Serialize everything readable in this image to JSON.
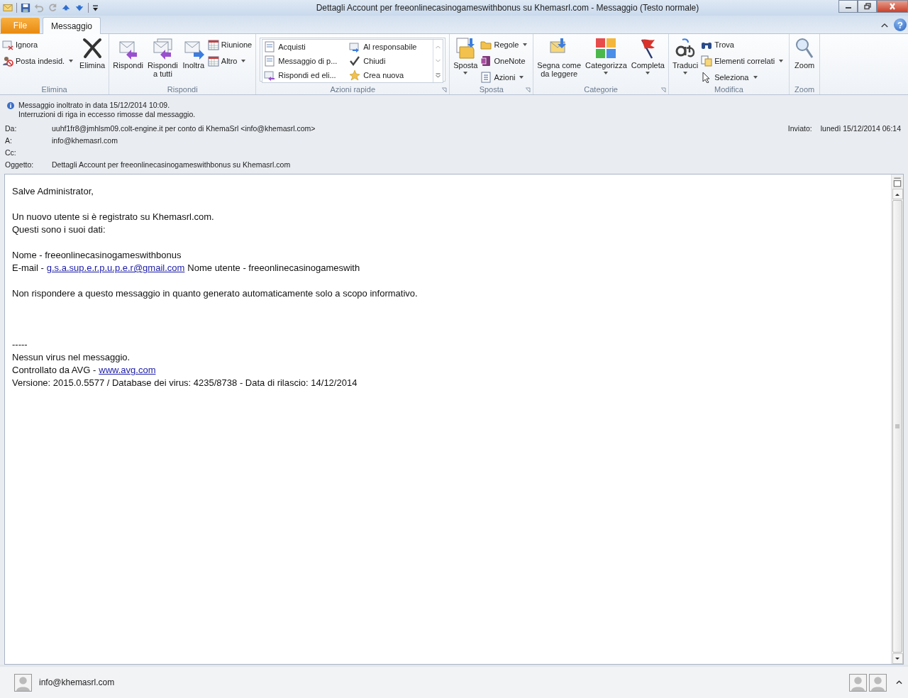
{
  "window": {
    "title": "Dettagli Account per freeonlinecasinogameswithbonus su Khemasrl.com  -  Messaggio (Testo normale)",
    "help": "?"
  },
  "tabs": [
    {
      "label": "File",
      "kind": "file",
      "selected": false
    },
    {
      "label": "Messaggio",
      "kind": "tab",
      "selected": true
    }
  ],
  "ribbon": {
    "groups": [
      {
        "label": "Elimina",
        "launcher": false,
        "columns": [
          {
            "kind": "small",
            "items": [
              {
                "lines": [
                  "Ignora"
                ],
                "dropdown": false
              },
              {
                "lines": [
                  "Posta indesid."
                ],
                "dropdown": true
              }
            ]
          },
          {
            "kind": "large",
            "items": [
              {
                "lines": [
                  "Elimina"
                ],
                "dropdown": false
              }
            ]
          }
        ]
      },
      {
        "label": "Rispondi",
        "launcher": false,
        "columns": [
          {
            "kind": "large",
            "items": [
              {
                "lines": [
                  "Rispondi"
                ],
                "dropdown": false
              }
            ]
          },
          {
            "kind": "large",
            "items": [
              {
                "lines": [
                  "Rispondi",
                  "a tutti"
                ],
                "dropdown": false
              }
            ]
          },
          {
            "kind": "large",
            "items": [
              {
                "lines": [
                  "Inoltra"
                ],
                "dropdown": false
              }
            ]
          },
          {
            "kind": "small",
            "items": [
              {
                "lines": [
                  "Riunione"
                ],
                "dropdown": false
              },
              {
                "lines": [
                  "Altro"
                ],
                "dropdown": true
              }
            ]
          }
        ]
      },
      {
        "label": "Azioni rapide",
        "launcher": true,
        "columns": [
          {
            "kind": "gallery",
            "items": [
              {
                "lines": [
                  "Acquisti"
                ]
              },
              {
                "lines": [
                  "Messaggio di p..."
                ]
              },
              {
                "lines": [
                  "Rispondi ed eli..."
                ]
              },
              {
                "lines": [
                  "Al responsabile"
                ]
              },
              {
                "lines": [
                  "Chiudi"
                ]
              },
              {
                "lines": [
                  "Crea nuova"
                ]
              }
            ]
          }
        ]
      },
      {
        "label": "Sposta",
        "launcher": true,
        "columns": [
          {
            "kind": "large",
            "items": [
              {
                "lines": [
                  "Sposta"
                ],
                "dropdown": true
              }
            ]
          },
          {
            "kind": "small",
            "items": [
              {
                "lines": [
                  "Regole"
                ],
                "dropdown": true
              },
              {
                "lines": [
                  "OneNote"
                ],
                "dropdown": false
              },
              {
                "lines": [
                  "Azioni"
                ],
                "dropdown": true
              }
            ]
          }
        ]
      },
      {
        "label": "Categorie",
        "launcher": true,
        "columns": [
          {
            "kind": "large",
            "items": [
              {
                "lines": [
                  "Segna come",
                  "da leggere"
                ],
                "dropdown": false
              }
            ]
          },
          {
            "kind": "large",
            "items": [
              {
                "lines": [
                  "Categorizza"
                ],
                "dropdown": true
              }
            ]
          },
          {
            "kind": "large",
            "items": [
              {
                "lines": [
                  "Completa"
                ],
                "dropdown": true
              }
            ]
          }
        ]
      },
      {
        "label": "Modifica",
        "launcher": false,
        "columns": [
          {
            "kind": "large",
            "items": [
              {
                "lines": [
                  "Traduci"
                ],
                "dropdown": true
              }
            ]
          },
          {
            "kind": "small",
            "items": [
              {
                "lines": [
                  "Trova"
                ],
                "dropdown": false
              },
              {
                "lines": [
                  "Elementi correlati"
                ],
                "dropdown": true
              },
              {
                "lines": [
                  "Seleziona"
                ],
                "dropdown": true
              }
            ]
          }
        ]
      },
      {
        "label": "Zoom",
        "launcher": false,
        "columns": [
          {
            "kind": "large",
            "items": [
              {
                "lines": [
                  "Zoom"
                ],
                "dropdown": false
              }
            ]
          }
        ]
      }
    ]
  },
  "info": {
    "lines": [
      "Messaggio inoltrato in data 15/12/2014 10:09.",
      "Interruzioni di riga in eccesso rimosse dal messaggio."
    ]
  },
  "header": {
    "fields": [
      {
        "label": "Da:",
        "value": "uuhf1fr8@jmhlsm09.colt-engine.it per conto di KhemaSrl <info@khemasrl.com>"
      },
      {
        "label": "A:",
        "value": "info@khemasrl.com"
      },
      {
        "label": "Cc:"
      },
      {
        "label": "Oggetto:",
        "value": "Dettagli Account per freeonlinecasinogameswithbonus su Khemasrl.com"
      }
    ],
    "sent": {
      "label": "Inviato:",
      "value": "lunedì 15/12/2014 06:14"
    }
  },
  "body": {
    "blocks": [
      {
        "kind": "paragraph",
        "lines": [
          [
            {
              "text": "Salve Administrator,"
            }
          ]
        ]
      },
      {
        "kind": "paragraph",
        "lines": [
          [
            {
              "text": "Un nuovo utente si è registrato su Khemasrl.com."
            }
          ],
          [
            {
              "text": "Questi sono i suoi dati:"
            }
          ]
        ]
      },
      {
        "kind": "paragraph",
        "lines": [
          [
            {
              "text": "Nome - freeonlinecasinogameswithbonus"
            }
          ],
          [
            {
              "text": "E-mail -"
            },
            {
              "text": "g.s.a.sup.e.r.p.u.p.e.r@gmail.com",
              "link": true
            },
            {
              "text": "Nome utente - freeonlinecasinogameswith"
            }
          ]
        ]
      },
      {
        "kind": "paragraph",
        "lines": [
          [
            {
              "text": "Non rispondere a questo messaggio in quanto generato automaticamente solo a scopo informativo."
            }
          ]
        ]
      },
      {
        "kind": "signature",
        "lines": [
          [
            {
              "text": "-----"
            }
          ],
          [
            {
              "text": "Nessun virus nel messaggio."
            }
          ],
          [
            {
              "text": "Controllato da AVG -"
            },
            {
              "text": "www.avg.com",
              "link": true
            }
          ],
          [
            {
              "text": "Versione: 2015.0.5577 / Database dei virus: 4235/8738 -  Data di rilascio: 14/12/2014"
            }
          ]
        ]
      }
    ]
  },
  "status_bar": {
    "contact": "info@khemasrl.com"
  }
}
